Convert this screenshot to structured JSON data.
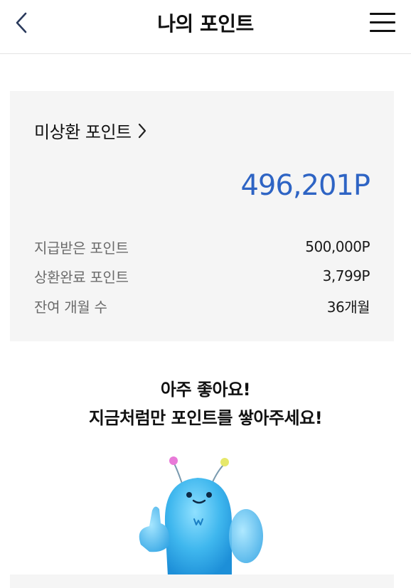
{
  "header": {
    "title": "나의 포인트",
    "back_icon": "chevron-left-icon",
    "menu_icon": "hamburger-menu-icon"
  },
  "summary": {
    "unredeemed_label": "미상환 포인트",
    "balance": "496,201P",
    "rows": [
      {
        "label": "지급받은 포인트",
        "value": "500,000P"
      },
      {
        "label": "상환완료 포인트",
        "value": "3,799P"
      },
      {
        "label": "잔여 개월 수",
        "value": "36개월"
      }
    ]
  },
  "message": {
    "line1": "아주 좋아요!",
    "line2": "지금처럼만 포인트를 쌓아주세요!"
  },
  "colors": {
    "accent": "#2e64c4",
    "card_bg": "#f5f5f5",
    "mascot": "#3fb7ee"
  }
}
